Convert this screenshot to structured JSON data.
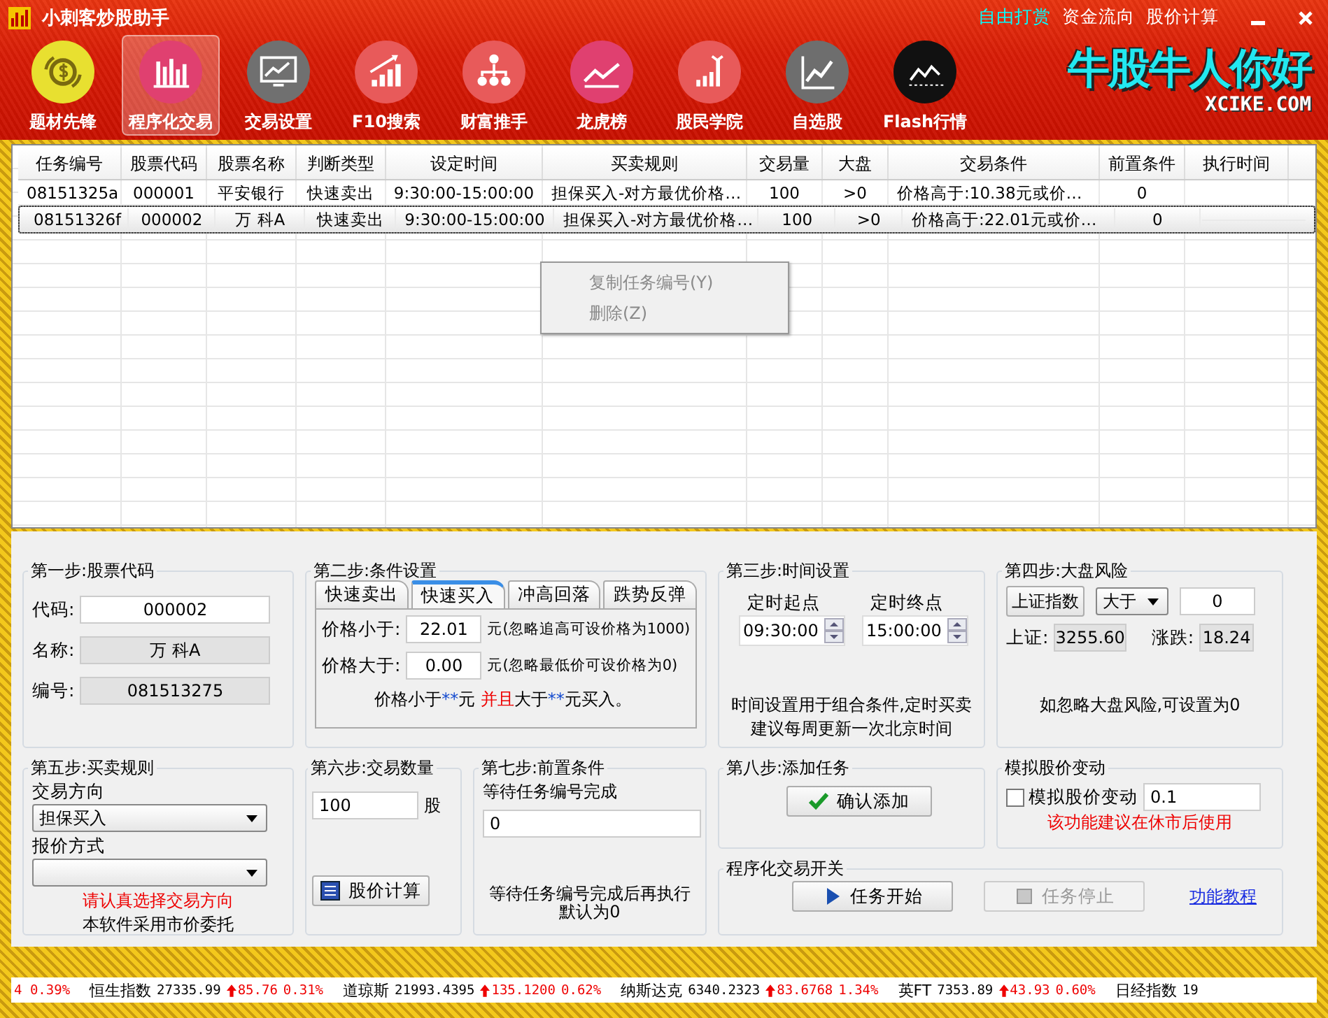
{
  "window": {
    "title": "小刺客炒股助手",
    "links": [
      {
        "label": "自由打赏",
        "color": "#00ffff"
      },
      {
        "label": "资金流向",
        "color": "#ffffff"
      },
      {
        "label": "股价计算",
        "color": "#ffffff"
      }
    ]
  },
  "toolbar": [
    {
      "label": "题材先锋",
      "kind": "coin",
      "color": "#e8e030",
      "selected": false
    },
    {
      "label": "程序化交易",
      "kind": "bars",
      "color": "#e04070",
      "selected": true
    },
    {
      "label": "交易设置",
      "kind": "monitor",
      "color": "#707070",
      "selected": false
    },
    {
      "label": "F10搜索",
      "kind": "growth",
      "color": "#e85a5a",
      "selected": false
    },
    {
      "label": "财富推手",
      "kind": "org",
      "color": "#e85a5a",
      "selected": false
    },
    {
      "label": "龙虎榜",
      "kind": "trend",
      "color": "#e04070",
      "selected": false
    },
    {
      "label": "股民学院",
      "kind": "tower",
      "color": "#e85a5a",
      "selected": false
    },
    {
      "label": "自选股",
      "kind": "line",
      "color": "#6e6e6e",
      "selected": false
    },
    {
      "label": "Flash行情",
      "kind": "flash",
      "color": "#111111",
      "selected": false
    }
  ],
  "logo": {
    "text": "牛股牛人你好",
    "subtext": "XCIKE.COM"
  },
  "table": {
    "columns": [
      "任务编号",
      "股票代码",
      "股票名称",
      "判断类型",
      "设定时间",
      "买卖规则",
      "交易量",
      "大盘",
      "交易条件",
      "前置条件",
      "执行时间"
    ],
    "rows": [
      {
        "cells": [
          "08151325a",
          "000001",
          "平安银行",
          "快速卖出",
          "9:30:00-15:00:00",
          "担保买入-对方最优价格…",
          "100",
          ">0",
          "价格高于:10.38元或价…",
          "0"
        ],
        "selected": false
      },
      {
        "cells": [
          "08151326f",
          "000002",
          "万 科A",
          "快速卖出",
          "9:30:00-15:00:00",
          "担保买入-对方最优价格…",
          "100",
          ">0",
          "价格高于:22.01元或价…",
          "0"
        ],
        "selected": true
      }
    ],
    "context_menu": [
      {
        "label": "复制任务编号(Y)",
        "disabled": true
      },
      {
        "label": "删除(Z)",
        "disabled": true
      }
    ]
  },
  "step1": {
    "title": "第一步:股票代码",
    "fields": [
      {
        "label": "代码:",
        "value": "000002",
        "kind": "input"
      },
      {
        "label": "名称:",
        "value": "万 科A",
        "kind": "readonly"
      },
      {
        "label": "编号:",
        "value": "081513275",
        "kind": "readonly"
      }
    ]
  },
  "step2": {
    "title": "第二步:条件设置",
    "tabs": [
      {
        "label": "快速卖出",
        "selected": false
      },
      {
        "label": "快速买入",
        "selected": true
      },
      {
        "label": "冲高回落",
        "selected": false
      },
      {
        "label": "跌势反弹",
        "selected": false
      }
    ],
    "fields": [
      {
        "label": "价格小于:",
        "value": "22.01",
        "hint": "元(忽略追高可设价格为1000)"
      },
      {
        "label": "价格大于:",
        "value": "0.00",
        "hint": "元(忽略最低价可设价格为0)"
      }
    ],
    "formula": [
      {
        "text": "价格小于",
        "kind": "plain"
      },
      {
        "text": "**",
        "kind": "value"
      },
      {
        "text": "元 ",
        "kind": "plain"
      },
      {
        "text": "并且",
        "kind": "emph"
      },
      {
        "text": "大于",
        "kind": "plain"
      },
      {
        "text": "**",
        "kind": "value"
      },
      {
        "text": "元买入。",
        "kind": "plain"
      }
    ]
  },
  "step3": {
    "title": "第三步:时间设置",
    "times": [
      {
        "label": "定时起点",
        "value": "09:30:00"
      },
      {
        "label": "定时终点",
        "value": "15:00:00"
      }
    ],
    "note": [
      "时间设置用于组合条件,定时买卖",
      "建议每周更新一次北京时间"
    ]
  },
  "step4": {
    "title": "第四步:大盘风险",
    "index_button": "上证指数",
    "comparator": "大于",
    "threshold": "0",
    "readings": [
      {
        "label": "上证:",
        "value": "3255.60"
      },
      {
        "label": "涨跌:",
        "value": "18.24"
      }
    ],
    "note": "如忽略大盘风险,可设置为0"
  },
  "step5": {
    "title": "第五步:买卖规则",
    "direction_label": "交易方向",
    "direction": "担保买入",
    "price_label": "报价方式",
    "warning": "请认真选择交易方向",
    "note": "本软件采用市价委托"
  },
  "step6": {
    "title": "第六步:交易数量",
    "quantity": "100",
    "unit": "股",
    "button": "股价计算"
  },
  "step7": {
    "title": "第七步:前置条件",
    "label": "等待任务编号完成",
    "value": "0",
    "note": [
      "等待任务编号完成后再执行",
      "默认为0"
    ]
  },
  "step8": {
    "title": "第八步:添加任务",
    "button": "确认添加"
  },
  "simulate": {
    "title": "模拟股价变动",
    "checked": false,
    "label": "模拟股价变动",
    "value": "0.1",
    "warning": "该功能建议在休市后使用"
  },
  "switch": {
    "title": "程序化交易开关",
    "buttons": [
      {
        "label": "任务开始",
        "disabled": false
      },
      {
        "label": "任务停止",
        "disabled": true
      }
    ],
    "link": "功能教程"
  },
  "ticker": [
    {
      "percent": "4 0.39%"
    },
    {
      "name": "恒生指数",
      "value": "27335.99",
      "change": "85.76",
      "percent": "0.31%"
    },
    {
      "name": "道琼斯",
      "value": "21993.4395",
      "change": "135.1200",
      "percent": "0.62%"
    },
    {
      "name": "纳斯达克",
      "value": "6340.2323",
      "change": "83.6768",
      "percent": "1.34%"
    },
    {
      "name": "英FT",
      "value": "7353.89",
      "change": "43.93",
      "percent": "0.60%"
    },
    {
      "name": "日经指数",
      "value": "19"
    }
  ]
}
